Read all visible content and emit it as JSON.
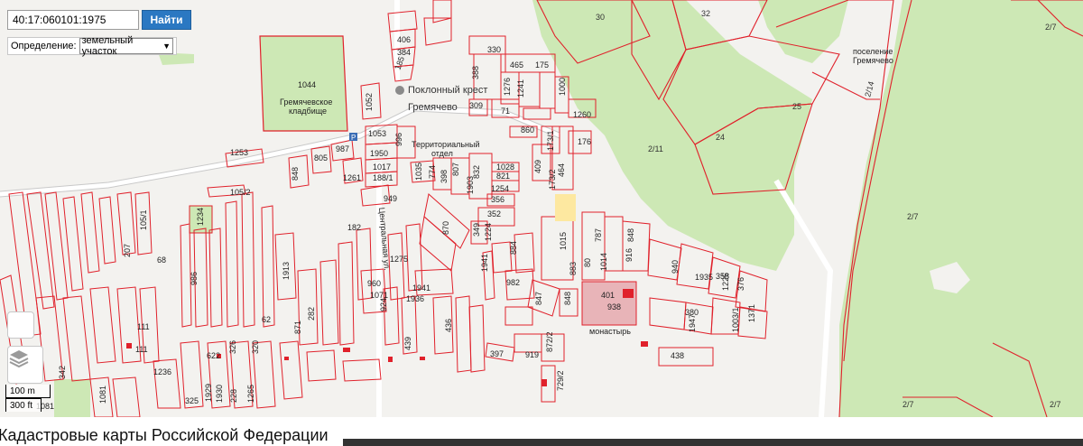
{
  "search": {
    "value": "40:17:060101:1975",
    "button_label": "Найти"
  },
  "definition": {
    "label": "Определение:",
    "selected": "земельный участок"
  },
  "map": {
    "places": {
      "village": "Гремячево",
      "cemetery_number": "1044",
      "cemetery_name_line1": "Гремячевское",
      "cemetery_name_line2": "кладбище",
      "cross": "Поклонный крест",
      "territorial_dept_line1": "Территориальный",
      "territorial_dept_line2": "отдел",
      "street": "Центральная ул.",
      "monastery": "монастырь",
      "settlement_line1": "поселение",
      "settlement_line2": "Гремячево",
      "road_shield": "Р"
    },
    "forest_labels": [
      "30",
      "32",
      "2/11",
      "24",
      "25",
      "2/14",
      "2/7",
      "2/7",
      "2/7",
      "2/7"
    ],
    "plot_labels": [
      "406",
      "384",
      "185",
      "330",
      "388",
      "465",
      "175",
      "1276",
      "1241",
      "1000",
      "309",
      "71",
      "1260",
      "1052",
      "1053",
      "996",
      "860",
      "173/1",
      "176",
      "1253",
      "987",
      "805",
      "848",
      "1950",
      "1017",
      "188/1",
      "1035",
      "774",
      "398",
      "807",
      "1903",
      "832",
      "1028",
      "821",
      "1254",
      "356",
      "409",
      "464",
      "173/2",
      "105/2",
      "1261",
      "949",
      "870",
      "352",
      "349",
      "1224",
      "884",
      "1015",
      "787",
      "848",
      "1234",
      "105/1",
      "207",
      "68",
      "182",
      "1275",
      "1913",
      "1941",
      "982",
      "883",
      "80",
      "1014",
      "916",
      "940",
      "1935",
      "358",
      "1225",
      "376",
      "986",
      "960",
      "1071",
      "1936",
      "1941",
      "401",
      "938",
      "847",
      "848",
      "1003/1",
      "1371",
      "1947",
      "380",
      "111",
      "62",
      "282",
      "871",
      "924",
      "436",
      "439",
      "111",
      "326",
      "320",
      "622",
      "1265",
      "1236",
      "1929",
      "1930",
      "228",
      "325",
      "1081",
      "397",
      "919",
      "872/2",
      "438",
      "729/2",
      "1081",
      "342"
    ],
    "tiles_note": ""
  },
  "scale": {
    "metric": "100 m",
    "imperial": "300 ft"
  },
  "footer": {
    "title": "Кадастровые карты Российской Федерации"
  },
  "colors": {
    "plot_border": "#e0212b",
    "forest": "#cde8b5",
    "background": "#f3f2ef",
    "button": "#2b78c2",
    "highlight_plot": "#e8b4b8",
    "yellow_plot": "#fde8a0"
  },
  "icons": {
    "layers": "layers-icon",
    "cross": "place-pin-icon"
  }
}
